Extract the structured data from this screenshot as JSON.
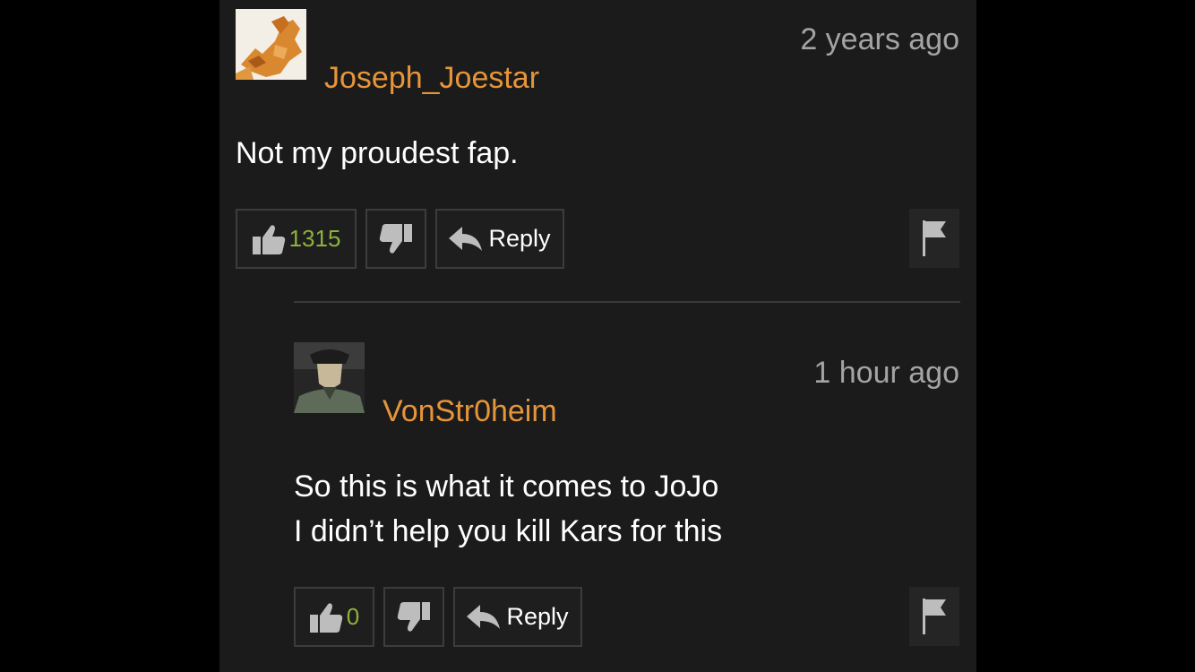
{
  "colors": {
    "page_bg": "#000000",
    "panel_bg": "#1b1b1b",
    "username": "#e6953a",
    "timestamp": "#a4a4a4",
    "vote_count": "#8eb23c",
    "button_border": "#3c3c3c"
  },
  "comments": [
    {
      "username": "Joseph_Joestar",
      "timestamp": "2 years ago",
      "lines": [
        "Not my proudest fap."
      ],
      "likes": "1315",
      "reply_label": "Reply",
      "icons": [
        "thumbs-up-icon",
        "thumbs-down-icon",
        "reply-arrow-icon",
        "flag-icon"
      ]
    },
    {
      "username": "VonStr0heim",
      "timestamp": "1 hour ago",
      "lines": [
        "So this is what it comes to JoJo",
        "I didn’t help you kill Kars for this"
      ],
      "likes": "0",
      "reply_label": "Reply",
      "icons": [
        "thumbs-up-icon",
        "thumbs-down-icon",
        "reply-arrow-icon",
        "flag-icon"
      ]
    }
  ]
}
